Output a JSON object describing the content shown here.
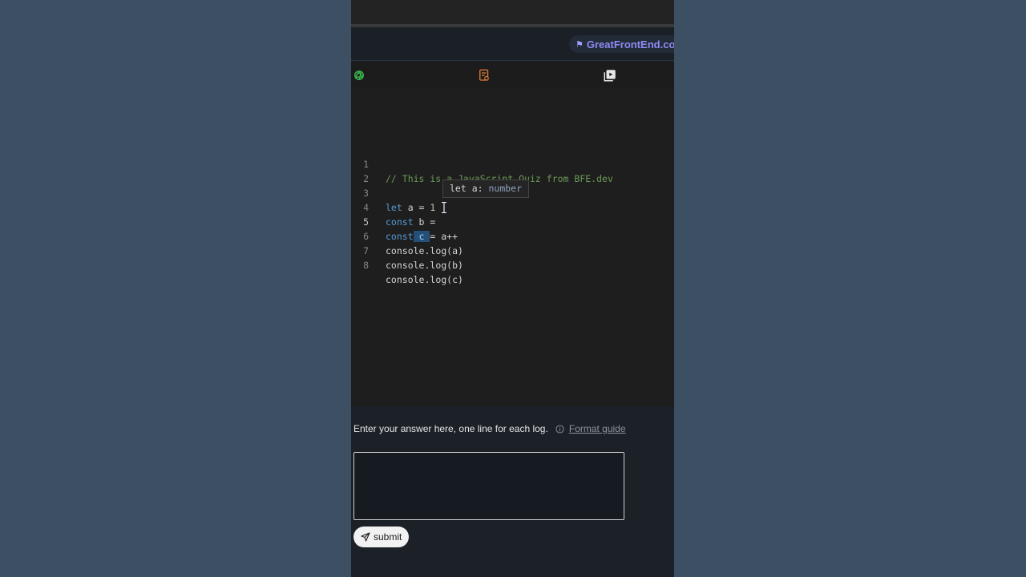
{
  "banner": {
    "promo_label": "GreatFrontEnd.com"
  },
  "toolbar": {
    "icons": [
      "openai-icon",
      "notes-icon",
      "video-icon"
    ],
    "colors": {
      "openai": "#36b14a",
      "notes": "#e07b39",
      "video": "#e6e6e6"
    }
  },
  "editor": {
    "lines": [
      {
        "num": "1",
        "comment": "// This is a JavaScript Quiz from BFE.dev"
      },
      {
        "num": "2"
      },
      {
        "num": "3",
        "kw": "let",
        "rest": " a = ",
        "num_val": "1"
      },
      {
        "num": "4",
        "kw": "const",
        "rest": " b = "
      },
      {
        "num": "5",
        "kw": "const",
        "sel": " c ",
        "rest": "= a++"
      },
      {
        "num": "6",
        "obj": "console.",
        "fn": "log",
        "args": "(a)"
      },
      {
        "num": "7",
        "obj": "console.",
        "fn": "log",
        "args": "(b)"
      },
      {
        "num": "8",
        "obj": "console.",
        "fn": "log",
        "args": "(c)"
      }
    ],
    "active_line": "5",
    "hover": {
      "prefix": "let a: ",
      "type": "number"
    }
  },
  "answer": {
    "label": "Enter your answer here, one line for each log.",
    "guide_link": "Format guide",
    "value": "",
    "submit_label": "submit"
  }
}
